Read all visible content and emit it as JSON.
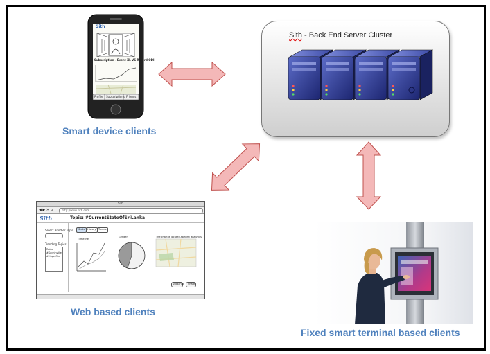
{
  "server": {
    "title_prefix": "Sith",
    "title_rest": " - Back End Server Cluster",
    "color_panel": "#e4e4e4",
    "color_server": "#2b3a8e"
  },
  "captions": {
    "smart_device": "Smart device clients",
    "web": "Web based clients",
    "terminal": "Fixed smart terminal based clients"
  },
  "phone": {
    "logo": "Sith",
    "subscription": "Subscription - Event XL VS RD 3rd ODI",
    "tabs": [
      "Profile",
      "Subscriptions",
      "Friends"
    ]
  },
  "web_mockup": {
    "window_title": "Sith",
    "url": "http://www.sith.com",
    "logo": "Sith",
    "topic": "Topic: #CurrentStateOfSriLanka",
    "select_label": "Select Another Topic",
    "trending_label": "Trending Topics",
    "trending_items": [
      "Rains",
      "#Sachinville",
      "#Hope One"
    ],
    "tabs": [
      "Stats",
      "History",
      "Trends"
    ],
    "chart_labels": [
      "Timeline",
      "Gender",
      "The chart is located-specific analytics"
    ],
    "buttons": [
      "Subscribe",
      "Share"
    ]
  },
  "colors": {
    "caption": "#4f81bd",
    "arrow_fill": "#f4b8b8",
    "arrow_stroke": "#c0504d"
  }
}
